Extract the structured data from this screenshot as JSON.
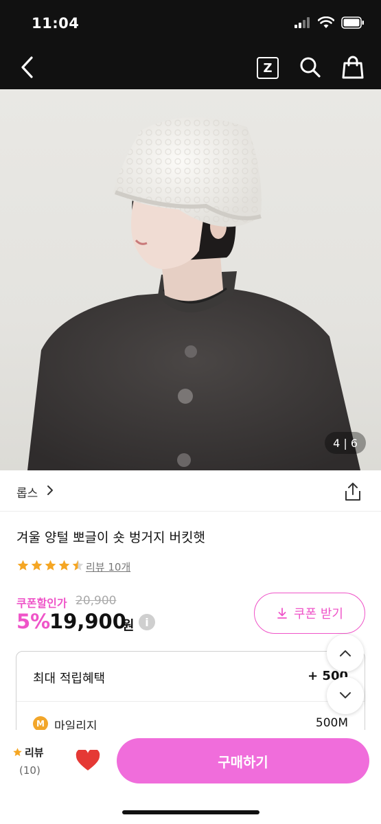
{
  "status": {
    "time": "11:04"
  },
  "nav": {
    "z_label": "Z"
  },
  "photo": {
    "page_indicator": "4 | 6"
  },
  "brand": {
    "name": "롭스"
  },
  "product": {
    "title": "겨울 양털 뽀글이 숏 벙거지 버킷햇",
    "rating": 4.5,
    "review_link": "리뷰 10개"
  },
  "price": {
    "coupon_label": "쿠폰할인가",
    "original": "20,900",
    "discount": "5%",
    "current": "19,900",
    "currency": "원",
    "info_icon": "i"
  },
  "coupon_button": {
    "label": "쿠폰 받기"
  },
  "benefits": {
    "max_label": "최대 적립혜택",
    "max_value": "+ 500",
    "mileage_icon": "M",
    "mileage_label": "마일리지",
    "mileage_value": "500M"
  },
  "bottom": {
    "review_label": "리뷰",
    "review_count": "(10)",
    "buy_label": "구매하기"
  },
  "colors": {
    "accent": "#ef54c8",
    "buy_button": "#f06ddb",
    "star": "#f5a623",
    "heart": "#e53935",
    "topbar": "#111111"
  }
}
